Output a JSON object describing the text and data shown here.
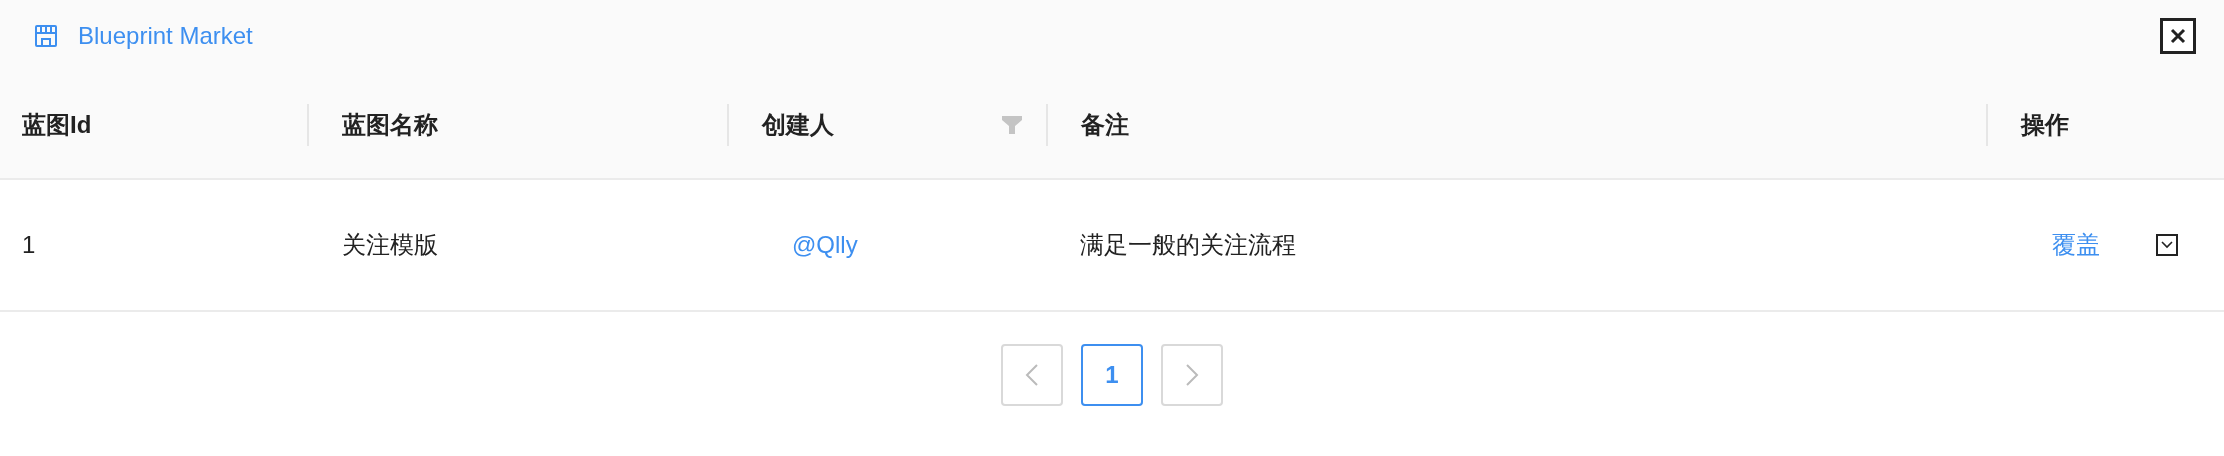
{
  "header": {
    "title": "Blueprint Market"
  },
  "table": {
    "columns": [
      {
        "label": "蓝图Id",
        "filter": false
      },
      {
        "label": "蓝图名称",
        "filter": false
      },
      {
        "label": "创建人",
        "filter": true
      },
      {
        "label": "备注",
        "filter": false
      },
      {
        "label": "操作",
        "filter": false
      }
    ],
    "rows": [
      {
        "id": "1",
        "name": "关注模版",
        "creator": "@Qlly",
        "remark": "满足一般的关注流程",
        "action": "覆盖",
        "expanded": false
      }
    ]
  },
  "pagination": {
    "prev_disabled": true,
    "next_disabled": true,
    "pages": [
      {
        "label": "1",
        "selected": true
      }
    ]
  }
}
